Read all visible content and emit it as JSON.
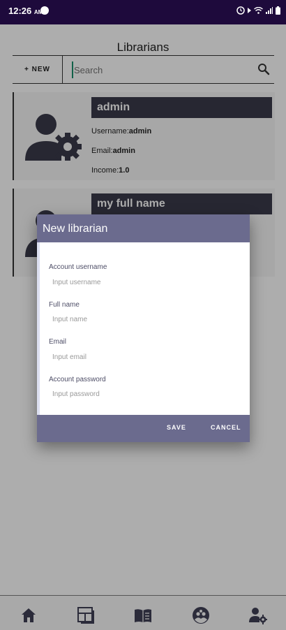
{
  "status_bar": {
    "time": "12:26",
    "ampm": "AM"
  },
  "page": {
    "title": "Librarians"
  },
  "toolbar": {
    "new_label": "+ NEW",
    "search_placeholder": "Search"
  },
  "librarians": [
    {
      "name": "admin",
      "username_label": "Username:",
      "username": "admin",
      "email_label": "Email:",
      "email": "admin",
      "income_label": "Income:",
      "income": "1.0"
    },
    {
      "name": "my full name"
    }
  ],
  "dialog": {
    "title": "New librarian",
    "fields": [
      {
        "label": "Account username",
        "placeholder": "Input username"
      },
      {
        "label": "Full name",
        "placeholder": "Input name"
      },
      {
        "label": "Email",
        "placeholder": "Input email"
      },
      {
        "label": "Account password",
        "placeholder": "Input password"
      }
    ],
    "save_label": "SAVE",
    "cancel_label": "CANCEL"
  },
  "bottom_nav": {
    "items": [
      {
        "icon": "home-icon"
      },
      {
        "icon": "dashboard-icon"
      },
      {
        "icon": "book-icon"
      },
      {
        "icon": "group-icon"
      },
      {
        "icon": "admin-settings-icon"
      }
    ]
  },
  "colors": {
    "status_bar": "#1e0a3c",
    "dialog_accent": "#6b6b8e",
    "card_name_bg": "#3a3a4a"
  }
}
